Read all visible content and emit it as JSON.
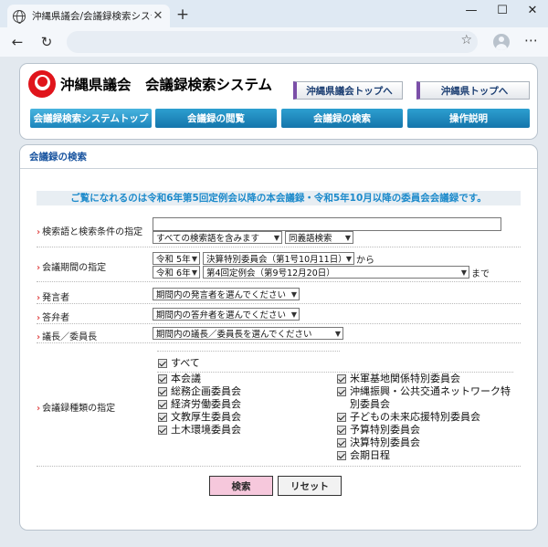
{
  "browser": {
    "tab_title": "沖縄県議会/会議録検索システム",
    "tab_close": "✕",
    "new_tab": "+",
    "minimize": "—",
    "maximize": "☐",
    "close": "✕",
    "back": "←",
    "reload": "↻",
    "star": "☆",
    "menu": "⋯"
  },
  "header": {
    "site_title": "沖縄県議会　会議録検索システム",
    "links": [
      "沖縄県議会トップへ",
      "沖縄県トップへ"
    ],
    "menu": [
      "会議録検索システムトップ",
      "会議録の閲覧",
      "会議録の検索",
      "操作説明"
    ]
  },
  "main": {
    "section_title": "会議録の検索",
    "notice": "ご覧になれるのは令和6年第5回定例会以降の本会議録・令和5年10月以降の委員会会議録です。"
  },
  "form": {
    "keyword_label": "検索語と検索条件の指定",
    "keyword_value": "",
    "keyword_condition": "すべての検索語を含みます",
    "synonym": "同義語検索",
    "period_label": "会議期間の指定",
    "from_year": "令和 5年",
    "from_session": "決算特別委員会（第1号10月11日）",
    "from_suffix": "から",
    "to_year": "令和 6年",
    "to_session": "第4回定例会（第9号12月20日）",
    "to_suffix": "まで",
    "speaker_label": "発言者",
    "speaker_value": "期間内の発言者を選んでください",
    "answerer_label": "答弁者",
    "answerer_value": "期間内の答弁者を選んでください",
    "chair_label": "議長／委員長",
    "chair_value": "期間内の議長／委員長を選んでください",
    "types_label": "会議録種類の指定",
    "all_label": "すべて",
    "types_left": [
      "本会議",
      "総務企画委員会",
      "経済労働委員会",
      "文教厚生委員会",
      "土木環境委員会"
    ],
    "types_right": [
      "米軍基地関係特別委員会",
      "沖縄振興・公共交通ネットワーク特別委員会",
      "子どもの未来応援特別委員会",
      "予算特別委員会",
      "決算特別委員会",
      "会期日程"
    ]
  },
  "buttons": {
    "search": "検索",
    "reset": "リセット"
  },
  "colors": {
    "menu_blue": "#1475ab",
    "notice_blue": "#1c8acb",
    "search_pink": "#f6c8dc",
    "logo_red": "#e0141b"
  }
}
